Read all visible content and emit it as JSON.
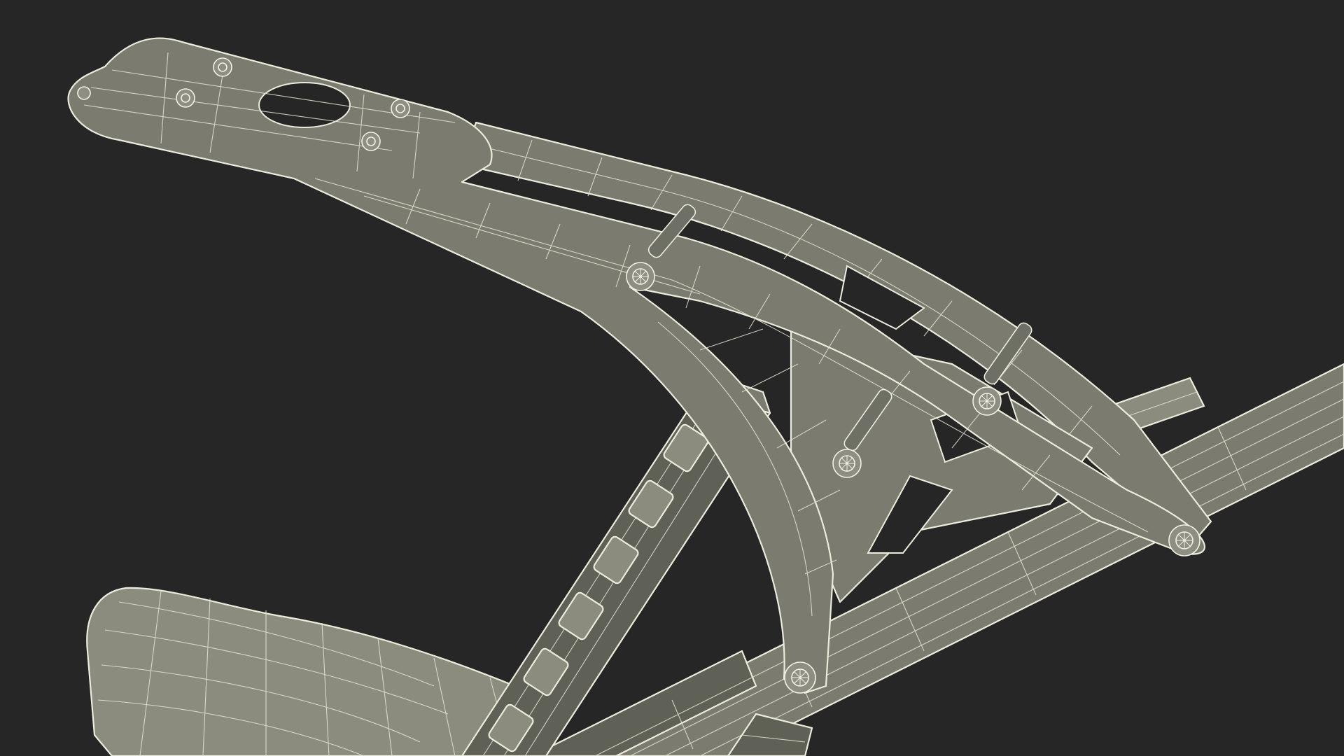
{
  "scene": {
    "subject": "wireframe-3d-model",
    "colors": {
      "background": "#262626",
      "surface": "#7b7c6f",
      "wire": "#ecebdc"
    }
  }
}
